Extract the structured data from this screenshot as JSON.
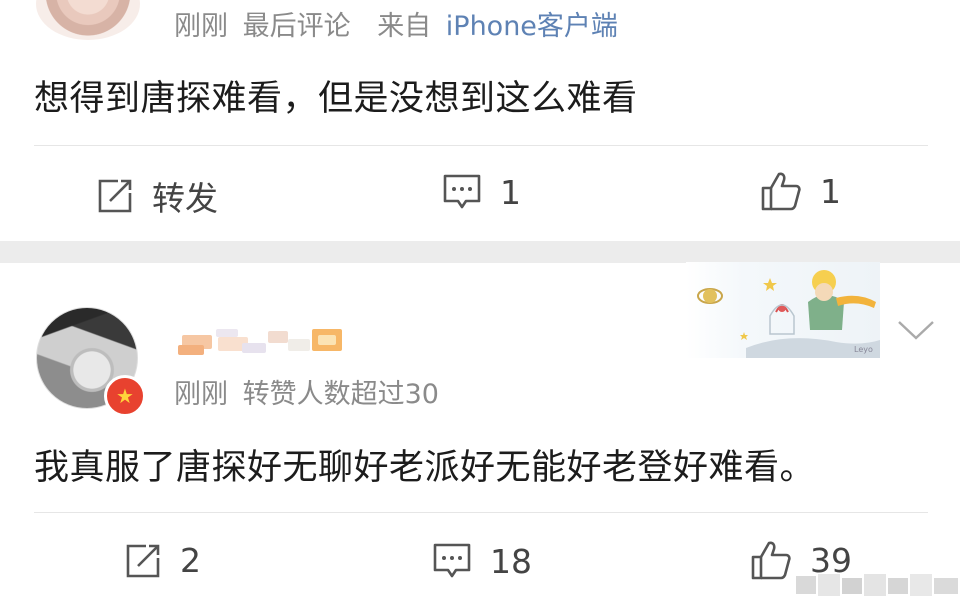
{
  "comment1": {
    "meta": {
      "time": "刚刚",
      "label": "最后评论",
      "source_prefix": "来自",
      "source": "iPhone客户端"
    },
    "text": "想得到唐探难看，但是没想到这么难看",
    "actions": {
      "repost_label": "转发",
      "comment_count": "1",
      "like_count": "1"
    }
  },
  "comment2": {
    "meta": {
      "time": "刚刚",
      "label": "转赞人数超过30"
    },
    "text": "我真服了唐探好无聊好老派好无能好老登好难看。",
    "actions": {
      "repost_count": "2",
      "comment_count": "18",
      "like_count": "39"
    }
  },
  "colors": {
    "source_link": "#5e82b4",
    "meta_gray": "#8a8a8a",
    "separator_band": "#ececec",
    "badge_red": "#e8422f"
  }
}
